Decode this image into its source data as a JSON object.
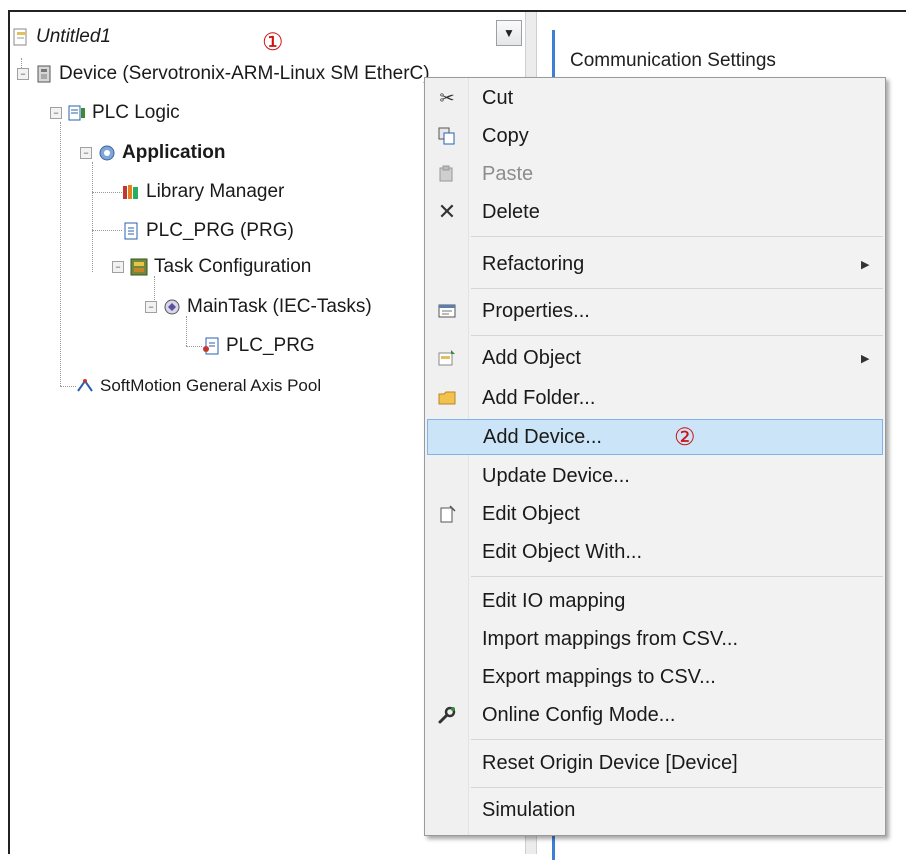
{
  "tree": {
    "project": "Untitled1",
    "device": "Device (Servotronix-ARM-Linux SM EtherC)",
    "plc_logic": "PLC Logic",
    "application": "Application",
    "library_manager": "Library Manager",
    "plc_prg_prg": "PLC_PRG (PRG)",
    "task_configuration": "Task Configuration",
    "main_task": "MainTask (IEC-Tasks)",
    "plc_prg": "PLC_PRG",
    "softmotion": "SoftMotion General Axis Pool"
  },
  "right_panel": {
    "tab_title": "Communication Settings"
  },
  "annotations": {
    "marker_1": "①",
    "marker_2": "②"
  },
  "context_menu": {
    "items": [
      {
        "label": "Cut",
        "icon": "scissors-icon"
      },
      {
        "label": "Copy",
        "icon": "copy-icon"
      },
      {
        "label": "Paste",
        "icon": "paste-icon",
        "disabled": true
      },
      {
        "label": "Delete",
        "icon": "delete-icon"
      },
      {
        "label": "Refactoring",
        "submenu": true
      },
      {
        "label": "Properties...",
        "icon": "properties-icon"
      },
      {
        "label": "Add Object",
        "icon": "add-object-icon",
        "submenu": true
      },
      {
        "label": "Add Folder...",
        "icon": "folder-icon"
      },
      {
        "label": "Add Device...",
        "highlighted": true
      },
      {
        "label": "Update Device..."
      },
      {
        "label": "Edit Object",
        "icon": "edit-object-icon"
      },
      {
        "label": "Edit Object With..."
      },
      {
        "label": "Edit IO mapping"
      },
      {
        "label": "Import mappings from CSV..."
      },
      {
        "label": "Export mappings to CSV..."
      },
      {
        "label": "Online Config Mode...",
        "icon": "wrench-icon"
      },
      {
        "label": "Reset Origin Device [Device]"
      },
      {
        "label": "Simulation"
      }
    ]
  },
  "colors": {
    "highlight": "#cce4f7",
    "highlight_border": "#7eb4ea",
    "annotation_red": "#cc1111",
    "panel_accent": "#3d7fd6"
  }
}
